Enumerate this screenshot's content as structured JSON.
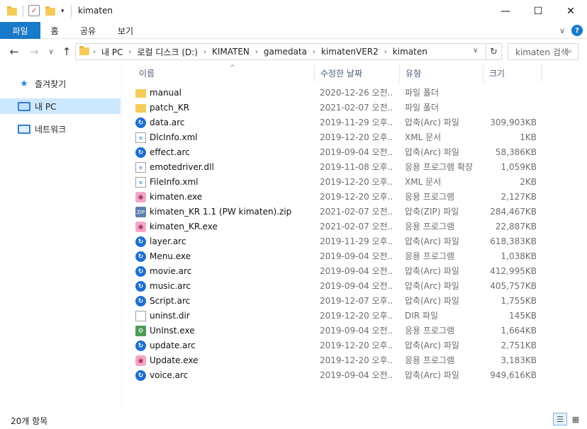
{
  "window": {
    "title": "kimaten",
    "minimize": "—",
    "maximize": "☐",
    "close": "✕"
  },
  "ribbon": {
    "tabs": [
      "파일",
      "홈",
      "공유",
      "보기"
    ],
    "expand": "∨",
    "help": "?"
  },
  "nav": {
    "back": "←",
    "forward": "→",
    "recent": "∨",
    "up": "↑",
    "breadcrumb": [
      "내 PC",
      "로컬 디스크 (D:)",
      "KIMATEN",
      "gamedata",
      "kimatenVER2",
      "kimaten"
    ],
    "dropdown": "∨",
    "refresh": "↻",
    "search_placeholder": "kimaten 검색"
  },
  "sidebar": {
    "items": [
      {
        "label": "즐겨찾기",
        "icon": "star-icon",
        "glyph": "★",
        "color": "#2a86d8"
      },
      {
        "label": "내 PC",
        "icon": "computer-icon",
        "glyph": "🖥",
        "color": "#3a7bd5"
      },
      {
        "label": "네트워크",
        "icon": "network-icon",
        "glyph": "🖧",
        "color": "#3a7bd5"
      }
    ],
    "selected_index": 1
  },
  "columns": {
    "name": "이름",
    "date": "수정한 날짜",
    "type": "유형",
    "size": "크기",
    "sort_arrow": "^"
  },
  "files": [
    {
      "name": "manual",
      "date": "2020-12-26 오전...",
      "type": "파일 폴더",
      "size": "",
      "icon": "folder"
    },
    {
      "name": "patch_KR",
      "date": "2021-02-07 오전...",
      "type": "파일 폴더",
      "size": "",
      "icon": "folder"
    },
    {
      "name": "data.arc",
      "date": "2019-11-29 오후...",
      "type": "압축(Arc) 파일",
      "size": "309,903KB",
      "icon": "arc"
    },
    {
      "name": "DlcInfo.xml",
      "date": "2019-12-20 오후...",
      "type": "XML 문서",
      "size": "1KB",
      "icon": "doc"
    },
    {
      "name": "effect.arc",
      "date": "2019-09-04 오전...",
      "type": "압축(Arc) 파일",
      "size": "58,386KB",
      "icon": "arc"
    },
    {
      "name": "emotedriver.dll",
      "date": "2019-11-08 오후...",
      "type": "응용 프로그램 확장",
      "size": "1,059KB",
      "icon": "doc"
    },
    {
      "name": "FileInfo.xml",
      "date": "2019-12-20 오후...",
      "type": "XML 문서",
      "size": "2KB",
      "icon": "doc"
    },
    {
      "name": "kimaten.exe",
      "date": "2019-12-20 오후...",
      "type": "응용 프로그램",
      "size": "2,127KB",
      "icon": "exe"
    },
    {
      "name": "kimaten_KR 1.1 (PW kimaten).zip",
      "date": "2021-02-07 오전...",
      "type": "압축(ZIP) 파일",
      "size": "284,467KB",
      "icon": "zip"
    },
    {
      "name": "kimaten_KR.exe",
      "date": "2021-02-07 오전...",
      "type": "응용 프로그램",
      "size": "22,887KB",
      "icon": "exe"
    },
    {
      "name": "layer.arc",
      "date": "2019-11-29 오후...",
      "type": "압축(Arc) 파일",
      "size": "618,383KB",
      "icon": "arc"
    },
    {
      "name": "Menu.exe",
      "date": "2019-09-04 오전...",
      "type": "응용 프로그램",
      "size": "1,038KB",
      "icon": "arc"
    },
    {
      "name": "movie.arc",
      "date": "2019-09-04 오전...",
      "type": "압축(Arc) 파일",
      "size": "412,995KB",
      "icon": "arc"
    },
    {
      "name": "music.arc",
      "date": "2019-09-04 오전...",
      "type": "압축(Arc) 파일",
      "size": "405,757KB",
      "icon": "arc"
    },
    {
      "name": "Script.arc",
      "date": "2019-12-07 오후...",
      "type": "압축(Arc) 파일",
      "size": "1,755KB",
      "icon": "arc"
    },
    {
      "name": "uninst.dir",
      "date": "2019-12-20 오후...",
      "type": "DIR 파일",
      "size": "145KB",
      "icon": "plain"
    },
    {
      "name": "UnInst.exe",
      "date": "2019-09-04 오전...",
      "type": "응용 프로그램",
      "size": "1,664KB",
      "icon": "setup"
    },
    {
      "name": "update.arc",
      "date": "2019-12-20 오후...",
      "type": "압축(Arc) 파일",
      "size": "2,751KB",
      "icon": "arc"
    },
    {
      "name": "Update.exe",
      "date": "2019-12-20 오후...",
      "type": "응용 프로그램",
      "size": "3,183KB",
      "icon": "exe"
    },
    {
      "name": "voice.arc",
      "date": "2019-09-04 오전...",
      "type": "압축(Arc) 파일",
      "size": "949,616KB",
      "icon": "arc"
    }
  ],
  "status": {
    "item_count": "20개 항목"
  },
  "colors": {
    "accent": "#1979ca",
    "selection": "#cce8ff",
    "folder": "#f5cc5a"
  }
}
